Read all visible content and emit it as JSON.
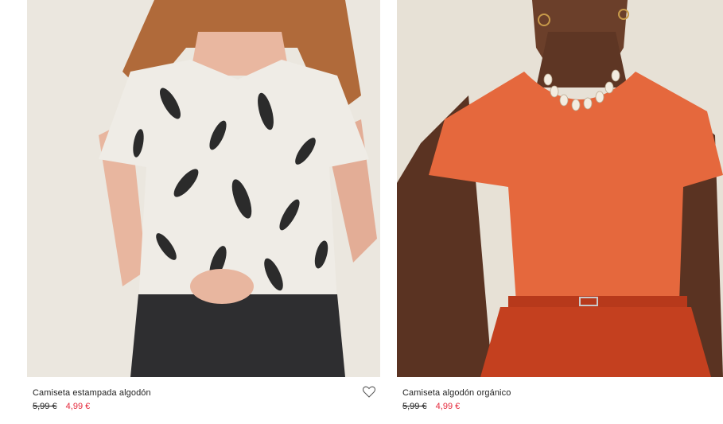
{
  "products": [
    {
      "name": "Camiseta estampada algodón",
      "old_price": "5,99 €",
      "sale_price": "4,99 €",
      "image_icon": "product-photo-icon",
      "wishlist_icon": "heart-outline-icon"
    },
    {
      "name": "Camiseta algodón orgánico",
      "old_price": "5,99 €",
      "sale_price": "4,99 €",
      "image_icon": "product-photo-icon"
    }
  ],
  "colors": {
    "sale": "#e5283b",
    "text": "#222222",
    "background": "#ffffff"
  }
}
